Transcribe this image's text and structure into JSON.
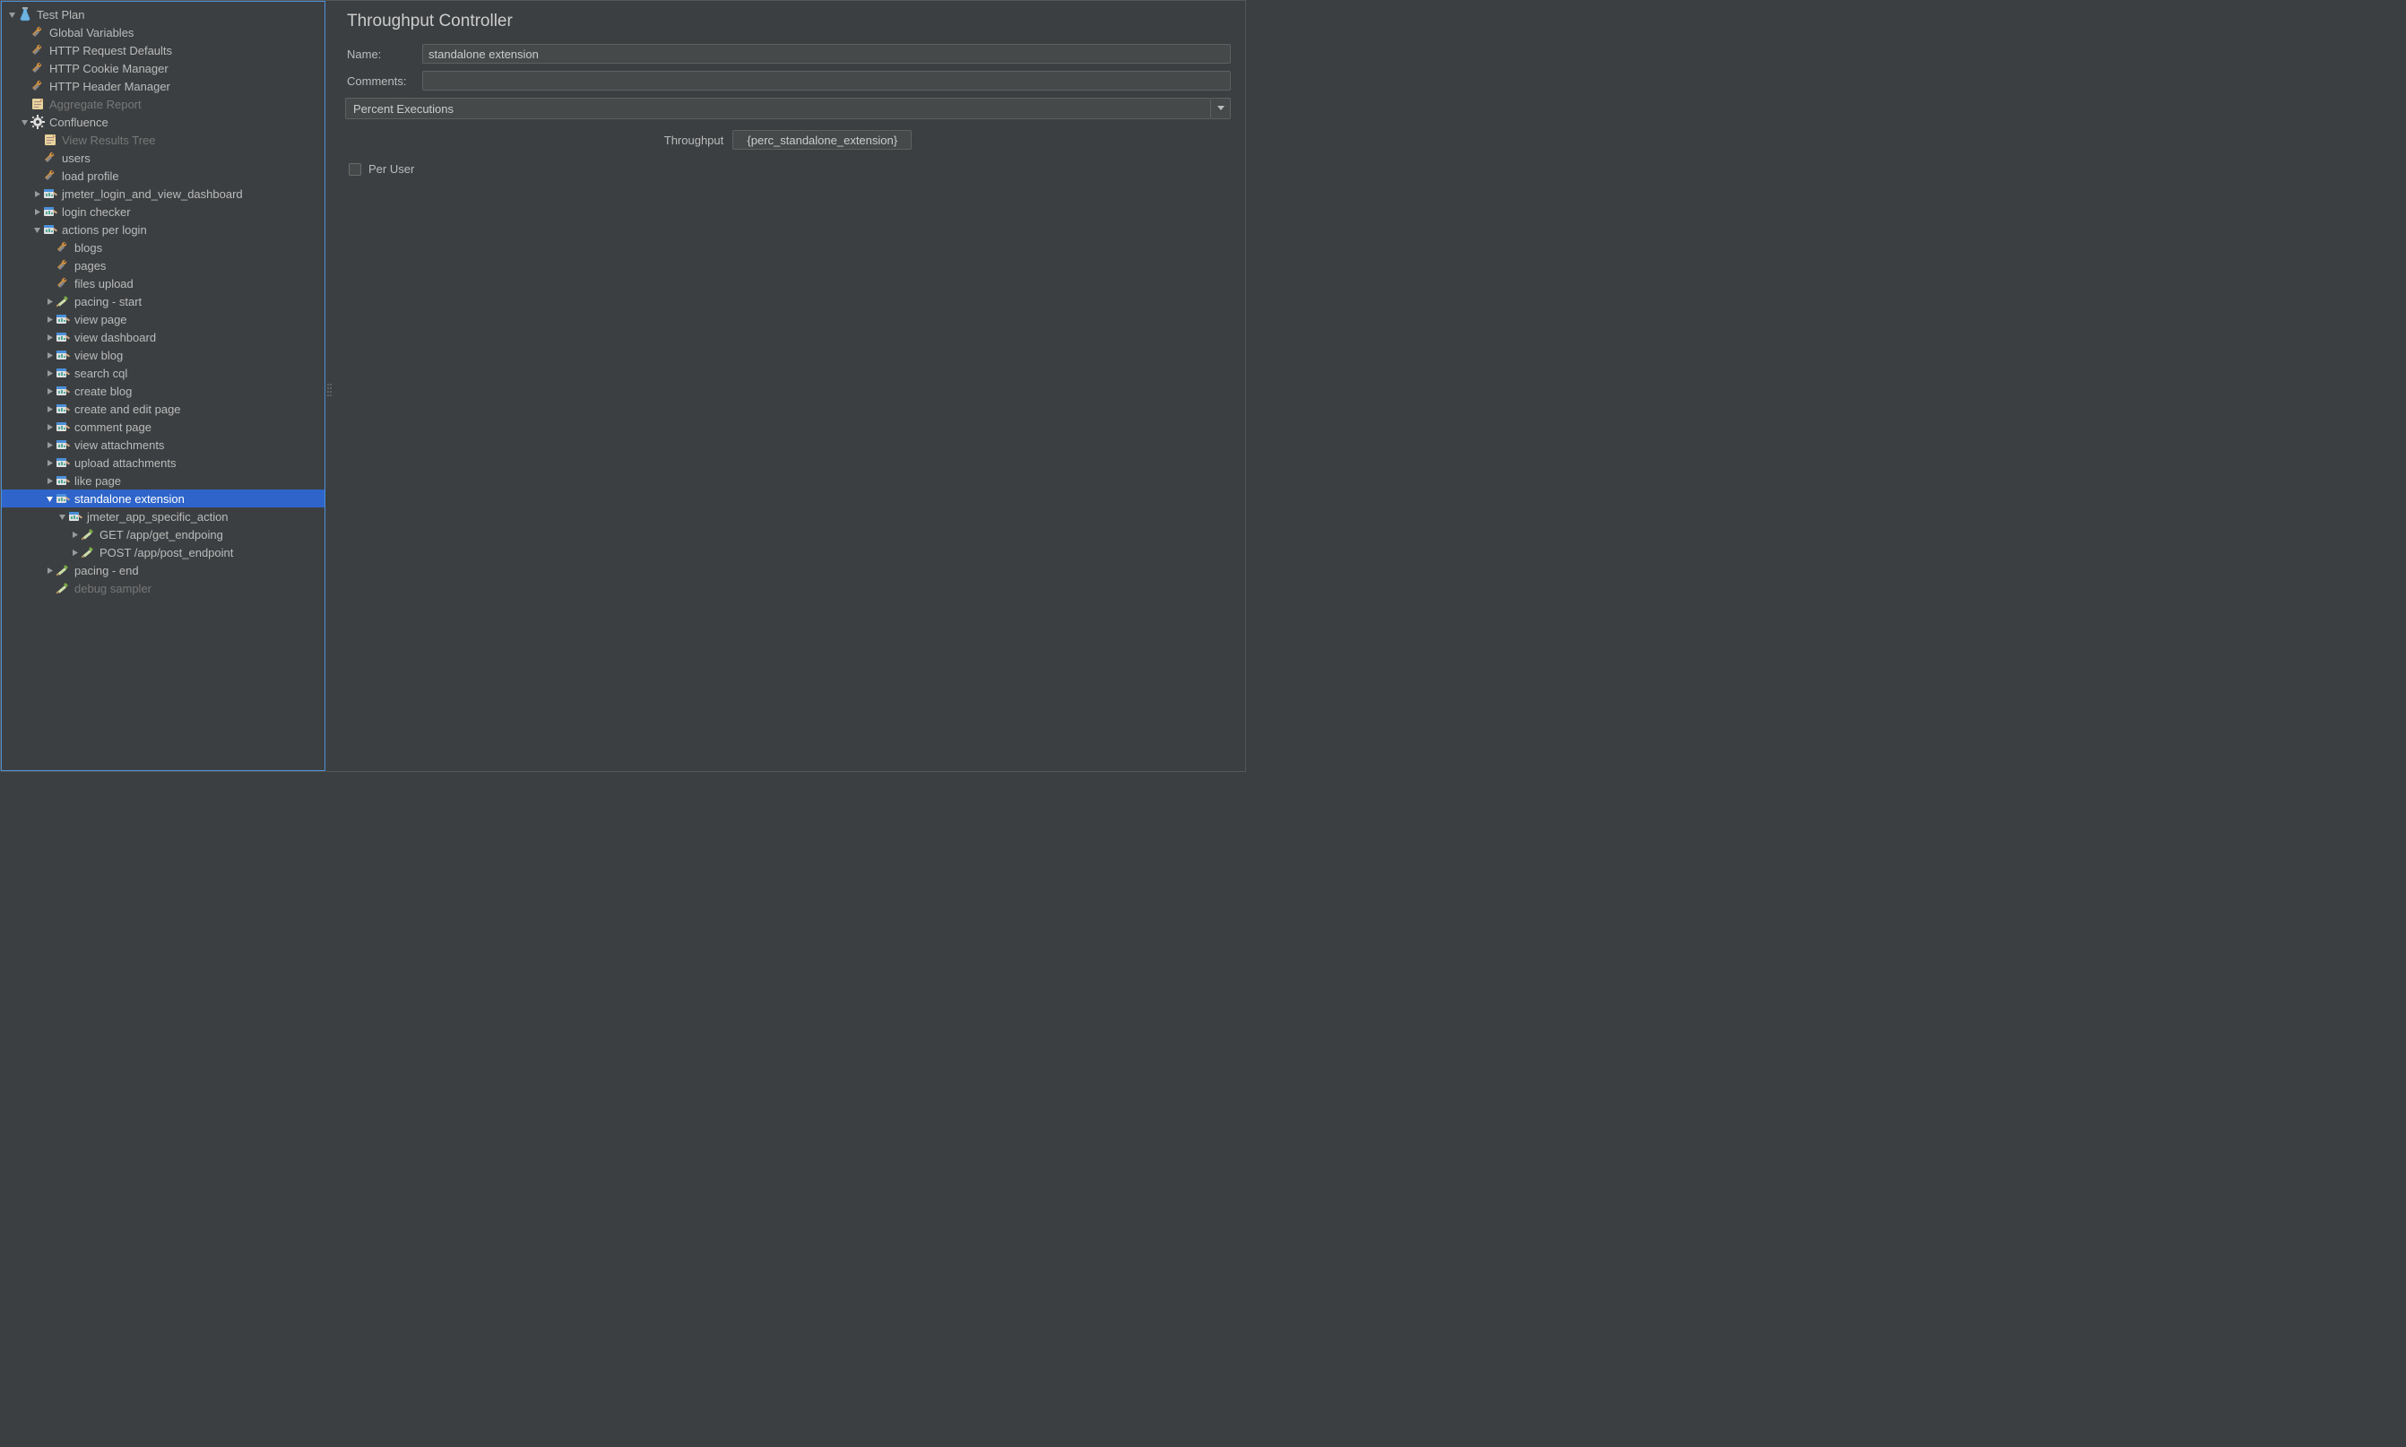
{
  "main": {
    "title": "Throughput Controller",
    "name_label": "Name:",
    "name_value": "standalone extension",
    "comments_label": "Comments:",
    "comments_value": "",
    "mode_selected": "Percent Executions",
    "throughput_label": "Throughput",
    "throughput_value": "{perc_standalone_extension}",
    "per_user_label": "Per User"
  },
  "tree": [
    {
      "depth": 0,
      "exp": "open",
      "icon": "flask",
      "label": "Test Plan"
    },
    {
      "depth": 1,
      "exp": "none",
      "icon": "wrench",
      "label": "Global Variables"
    },
    {
      "depth": 1,
      "exp": "none",
      "icon": "wrench",
      "label": "HTTP Request Defaults"
    },
    {
      "depth": 1,
      "exp": "none",
      "icon": "wrench",
      "label": "HTTP Cookie Manager"
    },
    {
      "depth": 1,
      "exp": "none",
      "icon": "wrench",
      "label": "HTTP Header Manager"
    },
    {
      "depth": 1,
      "exp": "none",
      "icon": "report",
      "label": "Aggregate Report",
      "dim": true
    },
    {
      "depth": 1,
      "exp": "open",
      "icon": "gear",
      "label": "Confluence"
    },
    {
      "depth": 2,
      "exp": "none",
      "icon": "report",
      "label": "View Results Tree",
      "dim": true
    },
    {
      "depth": 2,
      "exp": "none",
      "icon": "wrench",
      "label": "users"
    },
    {
      "depth": 2,
      "exp": "none",
      "icon": "wrench",
      "label": "load profile"
    },
    {
      "depth": 2,
      "exp": "closed",
      "icon": "controller",
      "label": "jmeter_login_and_view_dashboard"
    },
    {
      "depth": 2,
      "exp": "closed",
      "icon": "controller",
      "label": "login checker"
    },
    {
      "depth": 2,
      "exp": "open",
      "icon": "controller",
      "label": "actions per login"
    },
    {
      "depth": 3,
      "exp": "none",
      "icon": "wrench",
      "label": "blogs"
    },
    {
      "depth": 3,
      "exp": "none",
      "icon": "wrench",
      "label": "pages"
    },
    {
      "depth": 3,
      "exp": "none",
      "icon": "wrench",
      "label": "files upload"
    },
    {
      "depth": 3,
      "exp": "closed",
      "icon": "sampler",
      "label": "pacing - start"
    },
    {
      "depth": 3,
      "exp": "closed",
      "icon": "controller",
      "label": "view page"
    },
    {
      "depth": 3,
      "exp": "closed",
      "icon": "controller",
      "label": "view dashboard"
    },
    {
      "depth": 3,
      "exp": "closed",
      "icon": "controller",
      "label": "view blog"
    },
    {
      "depth": 3,
      "exp": "closed",
      "icon": "controller",
      "label": "search cql"
    },
    {
      "depth": 3,
      "exp": "closed",
      "icon": "controller",
      "label": "create blog"
    },
    {
      "depth": 3,
      "exp": "closed",
      "icon": "controller",
      "label": "create and edit page"
    },
    {
      "depth": 3,
      "exp": "closed",
      "icon": "controller",
      "label": "comment page"
    },
    {
      "depth": 3,
      "exp": "closed",
      "icon": "controller",
      "label": "view attachments"
    },
    {
      "depth": 3,
      "exp": "closed",
      "icon": "controller",
      "label": "upload attachments"
    },
    {
      "depth": 3,
      "exp": "closed",
      "icon": "controller",
      "label": "like page"
    },
    {
      "depth": 3,
      "exp": "open",
      "icon": "controller",
      "label": "standalone extension",
      "selected": true
    },
    {
      "depth": 4,
      "exp": "open",
      "icon": "controller",
      "label": "jmeter_app_specific_action"
    },
    {
      "depth": 5,
      "exp": "closed",
      "icon": "sampler",
      "label": "GET /app/get_endpoing"
    },
    {
      "depth": 5,
      "exp": "closed",
      "icon": "sampler",
      "label": "POST /app/post_endpoint"
    },
    {
      "depth": 3,
      "exp": "closed",
      "icon": "sampler",
      "label": "pacing - end"
    },
    {
      "depth": 3,
      "exp": "none",
      "icon": "sampler",
      "label": "debug sampler",
      "dim": true
    }
  ]
}
